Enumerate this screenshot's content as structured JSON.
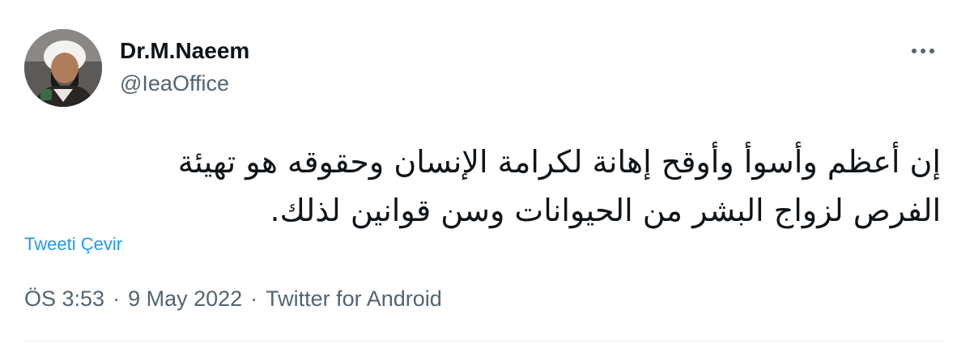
{
  "author": {
    "display_name": "Dr.M.Naeem",
    "handle": "@IeaOffice",
    "avatar_icon": "profile-photo"
  },
  "more_icon": "more-horizontal-icon",
  "tweet": {
    "text_lines": [
      "إن أعظم وأسوأ وأوقح إهانة لكرامة الإنسان وحقوقه هو تهيئة",
      "الفرص لزواج البشر من الحيوانات وسن قوانين لذلك."
    ],
    "translate_label": "Tweeti Çevir",
    "time": "ÖS 3:53",
    "date": "9 May 2022",
    "source": "Twitter for Android",
    "separator": "·"
  },
  "colors": {
    "text": "#0f1419",
    "secondary": "#536471",
    "link": "#1d9bf0",
    "divider": "#eff3f4"
  }
}
